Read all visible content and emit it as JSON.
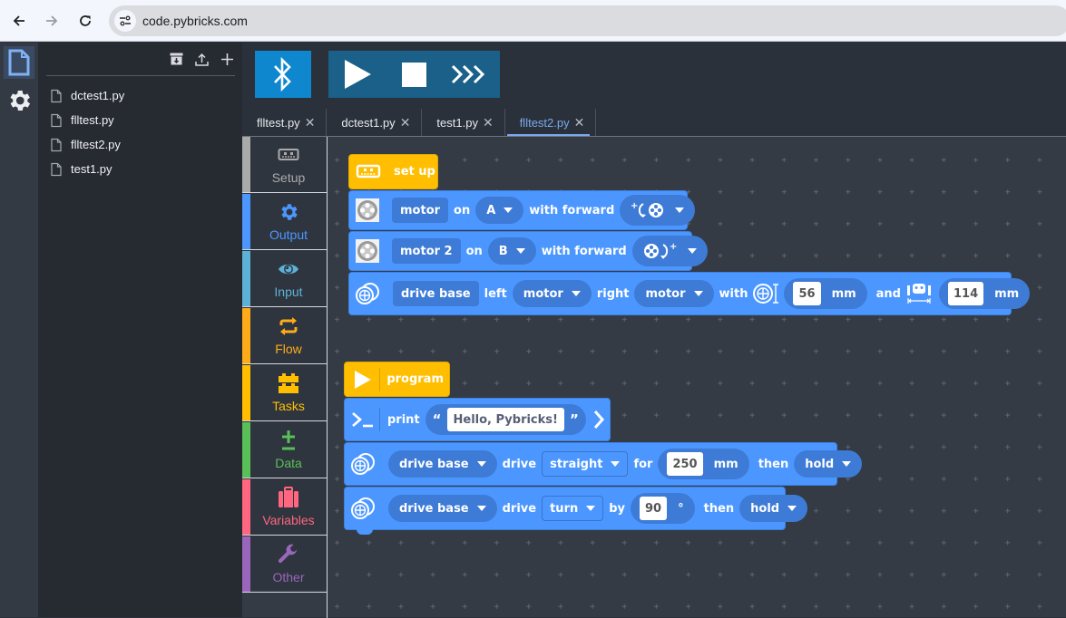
{
  "browser": {
    "url": "code.pybricks.com",
    "back_label": "Back",
    "forward_label": "Forward",
    "reload_label": "Reload"
  },
  "activity_bar": {
    "items": [
      {
        "name": "explorer",
        "icon": "file-icon",
        "active": true
      },
      {
        "name": "settings",
        "icon": "gear-icon",
        "active": false
      }
    ]
  },
  "explorer": {
    "toolbar": [
      {
        "name": "archive",
        "icon": "archive-icon"
      },
      {
        "name": "import",
        "icon": "upload-icon"
      },
      {
        "name": "new",
        "icon": "plus-icon"
      }
    ],
    "files": [
      "dctest1.py",
      "flltest.py",
      "flltest2.py",
      "test1.py"
    ]
  },
  "toolbar": {
    "bluetooth": "bluetooth-icon",
    "run": "play-icon",
    "stop": "stop-icon",
    "repl": "chevrons-icon",
    "colors": {
      "bluetooth_bg": "#0f87cf",
      "run_group_bg": "#1a6088"
    }
  },
  "tabs": [
    {
      "label": "flltest.py",
      "active": false
    },
    {
      "label": "dctest1.py",
      "active": false
    },
    {
      "label": "test1.py",
      "active": false
    },
    {
      "label": "flltest2.py",
      "active": true
    }
  ],
  "toolbox": {
    "categories": [
      {
        "label": "Setup",
        "color": "#aaaaaa",
        "icon": "hub-icon"
      },
      {
        "label": "Output",
        "color": "#4c97ff",
        "icon": "gear-icon"
      },
      {
        "label": "Input",
        "color": "#5cb1d6",
        "icon": "eye-icon"
      },
      {
        "label": "Flow",
        "color": "#ffab19",
        "icon": "loop-arrows-icon"
      },
      {
        "label": "Tasks",
        "color": "#ffbf00",
        "icon": "bricks-icon"
      },
      {
        "label": "Data",
        "color": "#59c059",
        "icon": "plus-minus-icon"
      },
      {
        "label": "Variables",
        "color": "#ff6680",
        "icon": "suitcase-icon"
      },
      {
        "label": "Other",
        "color": "#9966bb",
        "icon": "wrench-icon"
      }
    ]
  },
  "blocks": {
    "setup": {
      "hat_label": "set up",
      "motor1": {
        "type": "motor",
        "on": "on",
        "port": "A",
        "with_forward": "with forward",
        "direction": "counterclockwise"
      },
      "motor2": {
        "type": "motor 2",
        "on": "on",
        "port": "B",
        "with_forward": "with forward",
        "direction": "clockwise"
      },
      "drivebase": {
        "type": "drive base",
        "left": "left",
        "left_motor": "motor",
        "right": "right",
        "right_motor": "motor",
        "with": "with",
        "wheel_diameter": "56",
        "unit1": "mm",
        "and": "and",
        "axle_track": "114",
        "unit2": "mm"
      }
    },
    "program": {
      "hat_label": "program",
      "print": {
        "label": "print",
        "open_quote": "“",
        "value": "Hello, Pybricks!",
        "close_quote": "”"
      },
      "drive1": {
        "target": "drive base",
        "drive": "drive",
        "mode": "straight",
        "for": "for",
        "value": "250",
        "unit": "mm",
        "then": "then",
        "stop": "hold"
      },
      "drive2": {
        "target": "drive base",
        "drive": "drive",
        "mode": "turn",
        "by": "by",
        "value": "90",
        "unit": "°",
        "then": "then",
        "stop": "hold"
      }
    },
    "colors": {
      "hat": "#ffbf00",
      "statement": "#4c97ff",
      "field": "#3d7bd6"
    }
  }
}
